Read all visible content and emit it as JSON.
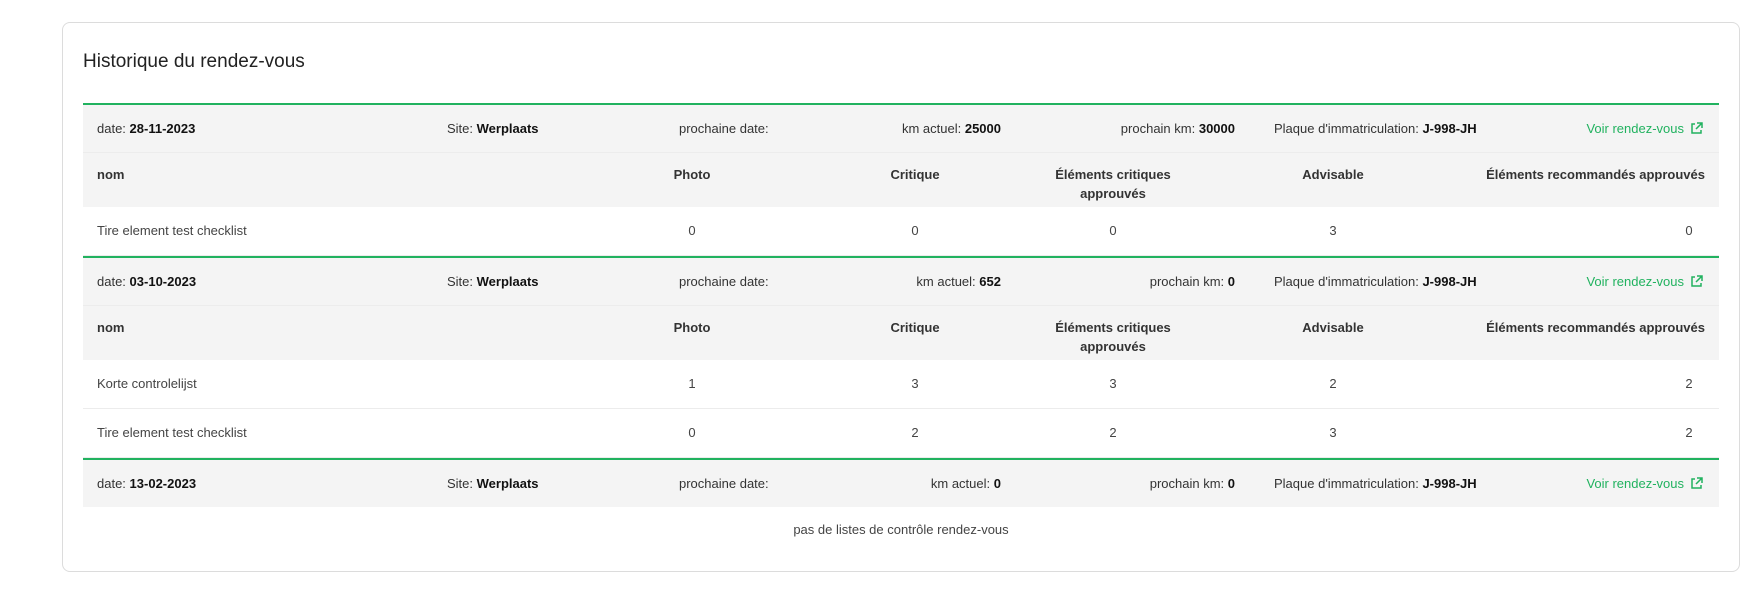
{
  "card": {
    "title": "Historique du rendez-vous"
  },
  "labels": {
    "date": "date:",
    "site": "Site:",
    "next_date": "prochaine date:",
    "km_current": "km actuel:",
    "next_km": "prochain km:",
    "plate": "Plaque d'immatriculation:",
    "view_link": "Voir rendez-vous"
  },
  "columns": {
    "name": "nom",
    "photo": "Photo",
    "critical": "Critique",
    "critical_approved": "Éléments critiques approuvés",
    "advisable": "Advisable",
    "recommended_approved": "Éléments recommandés approuvés"
  },
  "appointments": [
    {
      "date": "28-11-2023",
      "site": "Werplaats",
      "next_date": "",
      "km_current": "25000",
      "next_km": "30000",
      "plate": "J-998-JH",
      "rows": [
        {
          "name": "Tire element test checklist",
          "photo": "0",
          "critical": "0",
          "critical_approved": "0",
          "advisable": "3",
          "recommended_approved": "0"
        }
      ]
    },
    {
      "date": "03-10-2023",
      "site": "Werplaats",
      "next_date": "",
      "km_current": "652",
      "next_km": "0",
      "plate": "J-998-JH",
      "rows": [
        {
          "name": "Korte controlelijst",
          "photo": "1",
          "critical": "3",
          "critical_approved": "3",
          "advisable": "2",
          "recommended_approved": "2"
        },
        {
          "name": "Tire element test checklist",
          "photo": "0",
          "critical": "2",
          "critical_approved": "2",
          "advisable": "3",
          "recommended_approved": "2"
        }
      ]
    },
    {
      "date": "13-02-2023",
      "site": "Werplaats",
      "next_date": "",
      "km_current": "0",
      "next_km": "0",
      "plate": "J-998-JH",
      "empty_message": "pas de listes de contrôle rendez-vous"
    }
  ],
  "colors": {
    "accent": "#21b25f",
    "header_bg": "#f4f4f4",
    "border": "#dcdcdc"
  },
  "icons": {
    "view_link": "external-link-icon"
  }
}
